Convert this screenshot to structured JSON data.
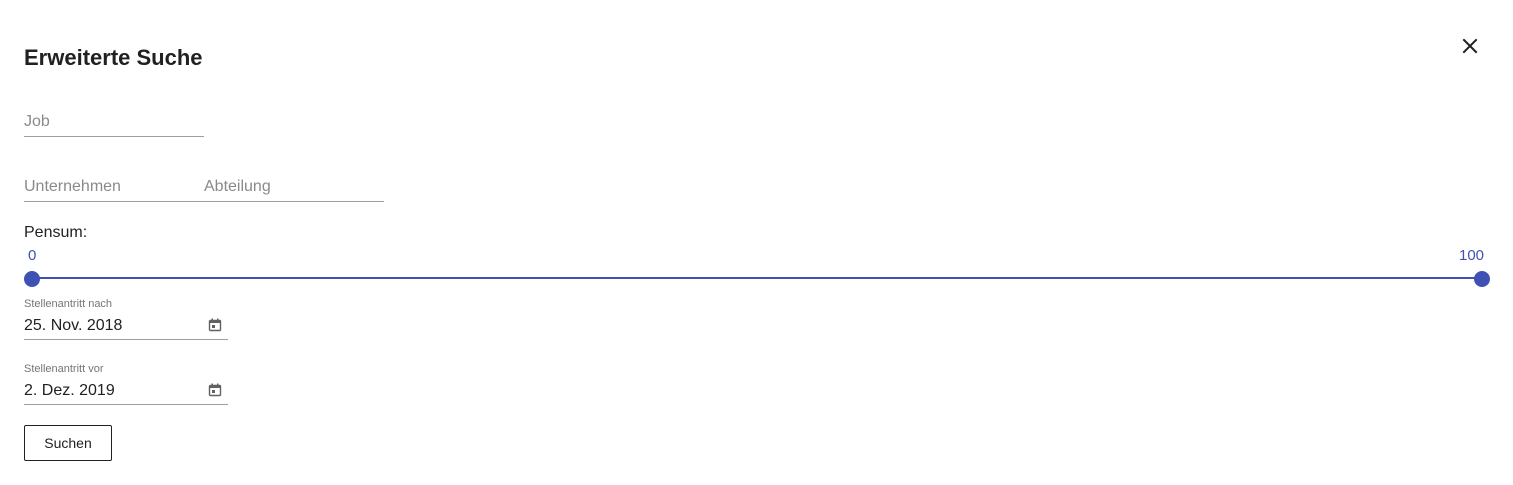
{
  "dialog": {
    "title": "Erweiterte Suche",
    "close_icon": "close-icon"
  },
  "fields": {
    "job_placeholder": "Job",
    "company_placeholder": "Unternehmen",
    "department_placeholder": "Abteilung"
  },
  "pensum": {
    "label": "Pensum:",
    "min_label": "0",
    "max_label": "100",
    "min_value": 0,
    "max_value": 100,
    "accent_color": "#3f51b5"
  },
  "start_after": {
    "label": "Stellenantritt nach",
    "value": "25. Nov. 2018",
    "icon": "calendar-icon"
  },
  "start_before": {
    "label": "Stellenantritt vor",
    "value": "2. Dez. 2019",
    "icon": "calendar-icon"
  },
  "actions": {
    "search_label": "Suchen"
  }
}
